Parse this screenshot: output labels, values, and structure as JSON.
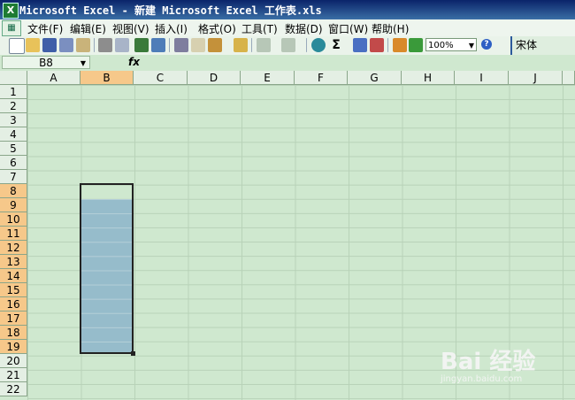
{
  "window": {
    "title": "Microsoft Excel - 新建 Microsoft Excel 工作表.xls"
  },
  "menu": [
    "文件(F)",
    "编辑(E)",
    "视图(V)",
    "插入(I)",
    "格式(O)",
    "工具(T)",
    "数据(D)",
    "窗口(W)",
    "帮助(H)"
  ],
  "toolbar": {
    "icons": [
      "new-icon",
      "open-icon",
      "save-icon",
      "permission-icon",
      "email-icon",
      "print-icon",
      "print-preview-icon",
      "spelling-icon",
      "research-icon",
      "cut-icon",
      "copy-icon",
      "paste-icon",
      "format-painter-icon",
      "undo-icon",
      "redo-icon",
      "hyperlink-icon",
      "autosum-icon",
      "sort-asc-icon",
      "sort-desc-icon",
      "chart-wizard-icon",
      "drawing-icon"
    ],
    "zoom": "100%",
    "font": "宋体"
  },
  "formula_bar": {
    "name_box": "B8",
    "fx": "fx"
  },
  "grid": {
    "columns": [
      "A",
      "B",
      "C",
      "D",
      "E",
      "F",
      "G",
      "H",
      "I",
      "J"
    ],
    "rows": [
      "1",
      "2",
      "3",
      "4",
      "5",
      "6",
      "7",
      "8",
      "9",
      "10",
      "11",
      "12",
      "13",
      "14",
      "15",
      "16",
      "17",
      "18",
      "19",
      "20",
      "21",
      "22"
    ],
    "selected_column": "B",
    "selected_rows": [
      "8",
      "9",
      "10",
      "11",
      "12",
      "13",
      "14",
      "15",
      "16",
      "17",
      "18",
      "19"
    ]
  },
  "watermark": {
    "main": "Bai 经验",
    "sub": "jingyan.baidu.com"
  },
  "colors": {
    "sheet_bg": "#cfe8cf",
    "selection_fill": "#96bccb",
    "header_selected": "#f6c88a",
    "title_bar": "#0a246a"
  }
}
